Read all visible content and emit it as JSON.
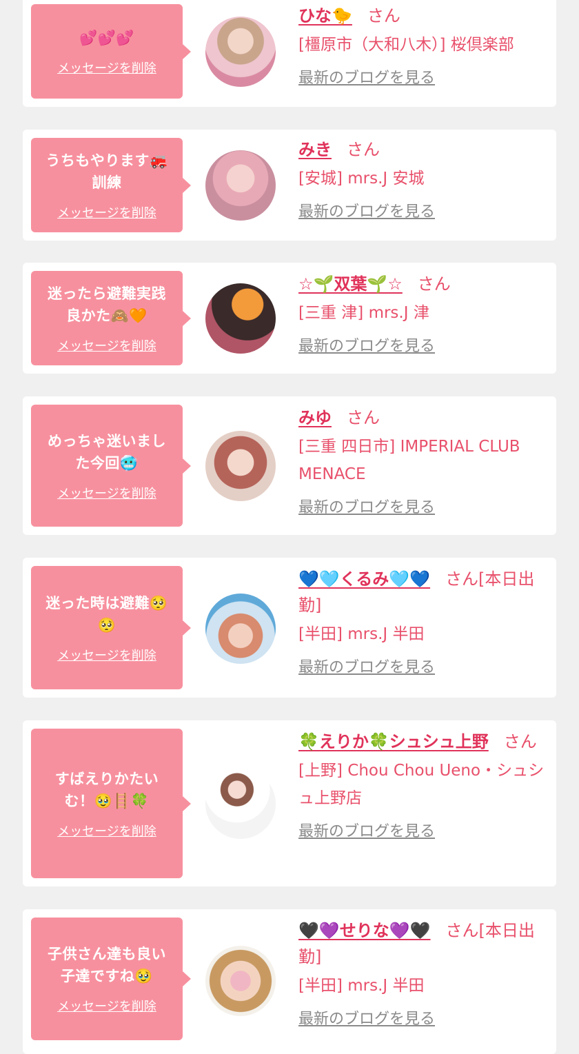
{
  "delete_label": "メッセージを削除",
  "blog_label": "最新のブログを見る",
  "colors": {
    "bubble": "#f7909e",
    "name": "#e0325a",
    "text": "#e8506b",
    "link_gray": "#8a8a8a",
    "bg": "#f0f0f0"
  },
  "entries": [
    {
      "message": "💕💕💕",
      "name": "ひな🐤",
      "suffix": "さん",
      "shop": "[橿原市（大和八木）] 桜倶楽部",
      "avatar": "avatar-photo"
    },
    {
      "message": "うちもやります🚒\n訓練",
      "name": "みき",
      "suffix": "さん",
      "shop": "[安城] mrs.J 安城",
      "avatar": "avatar-photo"
    },
    {
      "message": "迷ったら避難実践\n良かた🙈🧡",
      "name": "☆🌱双葉🌱☆",
      "suffix": "さん",
      "shop": "[三重 津] mrs.J 津",
      "avatar": "avatar-photo"
    },
    {
      "message": "めっちゃ迷いまし\nた今回🥶",
      "name": "みゆ",
      "suffix": "さん",
      "shop": "[三重 四日市] IMPERIAL CLUB MENACE",
      "avatar": "avatar-photo"
    },
    {
      "message": "迷った時は避難🥺\n🥺",
      "name": "💙🩵くるみ🩵💙",
      "suffix": "さん[本日出勤]",
      "shop": "[半田] mrs.J 半田",
      "avatar": "avatar-photo"
    },
    {
      "message": "すばえりかたい\nむ！🥹🪜🍀",
      "name": "🍀えりか🍀シュシュ上野",
      "suffix": "さん",
      "shop": "[上野] Chou Chou Ueno・シュシュ上野店",
      "avatar": "avatar-photo"
    },
    {
      "message": "子供さん達も良い\n子達ですね🥹",
      "name": "🖤💜せりな💜🖤",
      "suffix": "さん[本日出勤]",
      "shop": "[半田] mrs.J 半田",
      "avatar": "avatar-photo"
    }
  ]
}
